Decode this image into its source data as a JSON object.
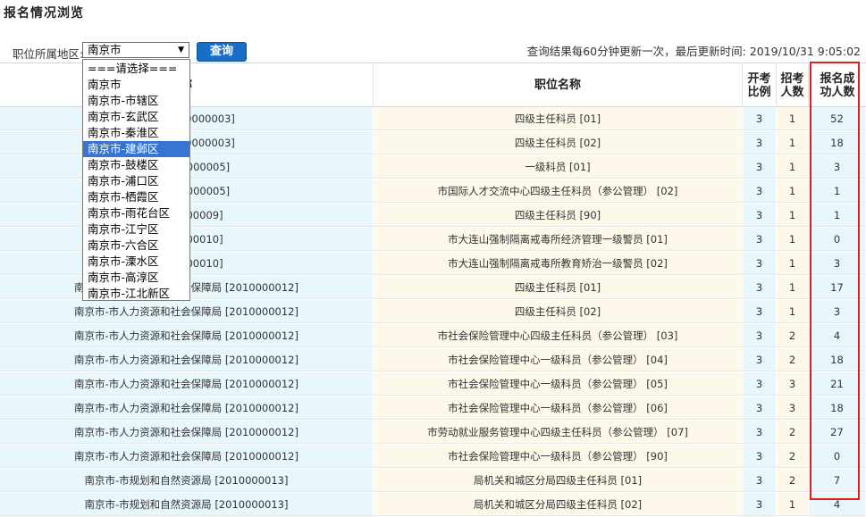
{
  "page": {
    "title": "报名情况浏览"
  },
  "filter": {
    "label": "职位所属地区:",
    "selected_region": "南京市",
    "query_button": "查询",
    "update_note": "查询结果每60分钟更新一次，最后更新时间: 2019/10/31 9:05:02"
  },
  "dropdown": {
    "options": [
      "===请选择===",
      "南京市",
      "南京市-市辖区",
      "南京市-玄武区",
      "南京市-秦淮区",
      "南京市-建邺区",
      "南京市-鼓楼区",
      "南京市-浦口区",
      "南京市-栖霞区",
      "南京市-雨花台区",
      "南京市-江宁区",
      "南京市-六合区",
      "南京市-溧水区",
      "南京市-高淳区",
      "南京市-江北新区"
    ],
    "highlighted_index": 5
  },
  "table": {
    "columns": [
      "称",
      "职位名称",
      "开考\n比例",
      "招考\n人数",
      "报名成\n功人数"
    ],
    "rows": [
      {
        "org": "化局 [2010000003]",
        "position": "四级主任科员 [01]",
        "ratio": "3",
        "quota": "1",
        "count": "52"
      },
      {
        "org": "化局 [2010000003]",
        "position": "四级主任科员 [02]",
        "ratio": "3",
        "quota": "1",
        "count": "18"
      },
      {
        "org": "局 [2010000005]",
        "position": "一级科员 [01]",
        "ratio": "3",
        "quota": "1",
        "count": "3"
      },
      {
        "org": "局 [2010000005]",
        "position": "市国际人才交流中心四级主任科员（参公管理） [02]",
        "ratio": "3",
        "quota": "1",
        "count": "1"
      },
      {
        "org": "[2010000009]",
        "position": "四级主任科员 [90]",
        "ratio": "3",
        "quota": "1",
        "count": "1"
      },
      {
        "org": "[2010000010]",
        "position": "市大连山强制隔离戒毒所经济管理一级警员 [01]",
        "ratio": "3",
        "quota": "1",
        "count": "0"
      },
      {
        "org": "[2010000010]",
        "position": "市大连山强制隔离戒毒所教育矫治一级警员 [02]",
        "ratio": "3",
        "quota": "1",
        "count": "3"
      },
      {
        "org": "南京市-市人力资源和社会保障局 [2010000012]",
        "position": "四级主任科员 [01]",
        "ratio": "3",
        "quota": "1",
        "count": "17"
      },
      {
        "org": "南京市-市人力资源和社会保障局 [2010000012]",
        "position": "四级主任科员 [02]",
        "ratio": "3",
        "quota": "1",
        "count": "3"
      },
      {
        "org": "南京市-市人力资源和社会保障局 [2010000012]",
        "position": "市社会保险管理中心四级主任科员（参公管理） [03]",
        "ratio": "3",
        "quota": "2",
        "count": "4"
      },
      {
        "org": "南京市-市人力资源和社会保障局 [2010000012]",
        "position": "市社会保险管理中心一级科员（参公管理） [04]",
        "ratio": "3",
        "quota": "2",
        "count": "18"
      },
      {
        "org": "南京市-市人力资源和社会保障局 [2010000012]",
        "position": "市社会保险管理中心一级科员（参公管理） [05]",
        "ratio": "3",
        "quota": "3",
        "count": "21"
      },
      {
        "org": "南京市-市人力资源和社会保障局 [2010000012]",
        "position": "市社会保险管理中心一级科员（参公管理） [06]",
        "ratio": "3",
        "quota": "3",
        "count": "18"
      },
      {
        "org": "南京市-市人力资源和社会保障局 [2010000012]",
        "position": "市劳动就业服务管理中心四级主任科员（参公管理） [07]",
        "ratio": "3",
        "quota": "2",
        "count": "27"
      },
      {
        "org": "南京市-市人力资源和社会保障局 [2010000012]",
        "position": "市社会保险管理中心一级科员（参公管理） [90]",
        "ratio": "3",
        "quota": "2",
        "count": "0"
      },
      {
        "org": "南京市-市规划和自然资源局 [2010000013]",
        "position": "局机关和城区分局四级主任科员 [01]",
        "ratio": "3",
        "quota": "2",
        "count": "7"
      },
      {
        "org": "南京市-市规划和自然资源局 [2010000013]",
        "position": "局机关和城区分局四级主任科员 [02]",
        "ratio": "3",
        "quota": "1",
        "count": "4"
      }
    ]
  },
  "colors": {
    "accent_button": "#1a6fc4",
    "highlight_box": "#e11d1d",
    "dropdown_selected": "#3874d1",
    "org_column_bg": "#e8f7fb",
    "position_column_bg": "#fdf8ea"
  },
  "icons": {
    "select_arrow": "caret-down-icon"
  }
}
